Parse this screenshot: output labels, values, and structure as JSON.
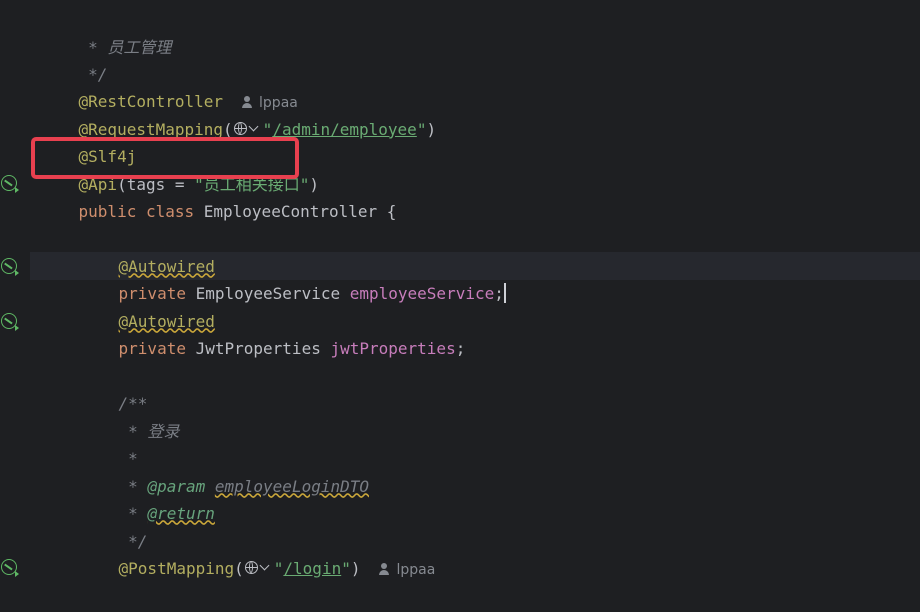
{
  "editor": {
    "lines": {
      "l1": {
        "text": " * 员工管理"
      },
      "l2": {
        "text": " */"
      },
      "l3": {
        "anno": "@RestController",
        "author": "lppaa"
      },
      "l4": {
        "anno": "@RequestMapping",
        "open": "(",
        "q1": "\"",
        "url": "/admin/employee",
        "q2": "\"",
        "close": ")"
      },
      "l5": {
        "anno": "@Slf4j"
      },
      "l6": {
        "anno": "@Api",
        "mid": "(tags = ",
        "str": "\"员工相关接口\"",
        "close": ")"
      },
      "l7": {
        "kw": "public class",
        "name": " EmployeeController {"
      },
      "l9": {
        "anno": "@Autowired"
      },
      "l10": {
        "kw": "private",
        "type": " EmployeeService ",
        "field": "employeeService",
        "semi": ";"
      },
      "l11": {
        "anno": "@Autowired"
      },
      "l12": {
        "kw": "private",
        "type": " JwtProperties ",
        "field": "jwtProperties",
        "semi": ";"
      },
      "l14": {
        "text": "/**"
      },
      "l15": {
        "text": " * 登录"
      },
      "l16": {
        "text": " *"
      },
      "l17": {
        "prefix": " * ",
        "tag": "@param",
        "space": " ",
        "ref": "employeeLoginDTO"
      },
      "l18": {
        "prefix": " * ",
        "tag": "@return"
      },
      "l19": {
        "text": " */"
      },
      "l20": {
        "anno": "@PostMapping",
        "open": "(",
        "q1": "\"",
        "url": "/login",
        "q2": "\"",
        "close": ")",
        "author": "lppaa"
      }
    }
  },
  "icons": {
    "gutter": "spring-bean-icon",
    "url": "globe-icon",
    "author": "person-icon"
  },
  "colors": {
    "background": "#1e1f22",
    "annotation": "#b3ae60",
    "keyword": "#cf8e6d",
    "string": "#6aab73",
    "field": "#c77dbb",
    "comment": "#7a7e85",
    "highlight_box": "#e8404f",
    "gutter_icon": "#5fb865"
  }
}
